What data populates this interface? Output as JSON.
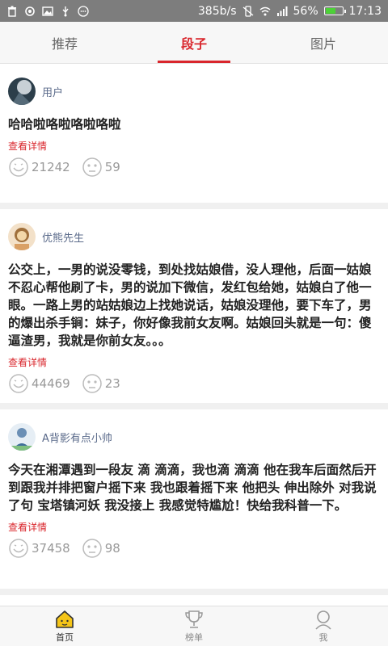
{
  "status_bar": {
    "speed": "385b/s",
    "battery": "56%",
    "battery_fraction": 0.56,
    "time": "17:13"
  },
  "tabs": [
    {
      "label": "推荐",
      "active": false
    },
    {
      "label": "段子",
      "active": true
    },
    {
      "label": "图片",
      "active": false
    }
  ],
  "posts": [
    {
      "user": "用户",
      "content": "哈哈啦咯啦咯啦咯啦",
      "detail": "查看详情",
      "likes": "21242",
      "dislikes": "59"
    },
    {
      "user": "优熊先生",
      "content": "公交上，一男的说没零钱，到处找姑娘借，没人理他，后面一姑娘不忍心帮他刷了卡，男的说加下微信，发红包给她，姑娘白了他一眼。一路上男的站姑娘边上找她说话，姑娘没理他，要下车了，男的爆出杀手锏：妹子，你好像我前女友啊。姑娘回头就是一句：傻逼渣男，我就是你前女友。。。",
      "detail": "查看详情",
      "likes": "44469",
      "dislikes": "23"
    },
    {
      "user": "A背影有点小帅",
      "content": "今天在湘潭遇到一段友 滴 滴滴，我也滴 滴滴 他在我车后面然后开到跟我并排把窗户摇下来 我也跟着摇下来 他把头 伸出除外 对我说了句 宝塔镇河妖 我没接上 我感觉特尴尬！快给我科普一下。",
      "detail": "查看详情",
      "likes": "37458",
      "dislikes": "98"
    }
  ],
  "bottom_nav": [
    {
      "label": "首页",
      "icon": "home-icon",
      "active": true
    },
    {
      "label": "榜单",
      "icon": "trophy-icon",
      "active": false
    },
    {
      "label": "我",
      "icon": "user-icon",
      "active": false
    }
  ],
  "colors": {
    "accent": "#d9262c",
    "status_bar": "#7d7d7d",
    "username": "#5a6a8a"
  }
}
